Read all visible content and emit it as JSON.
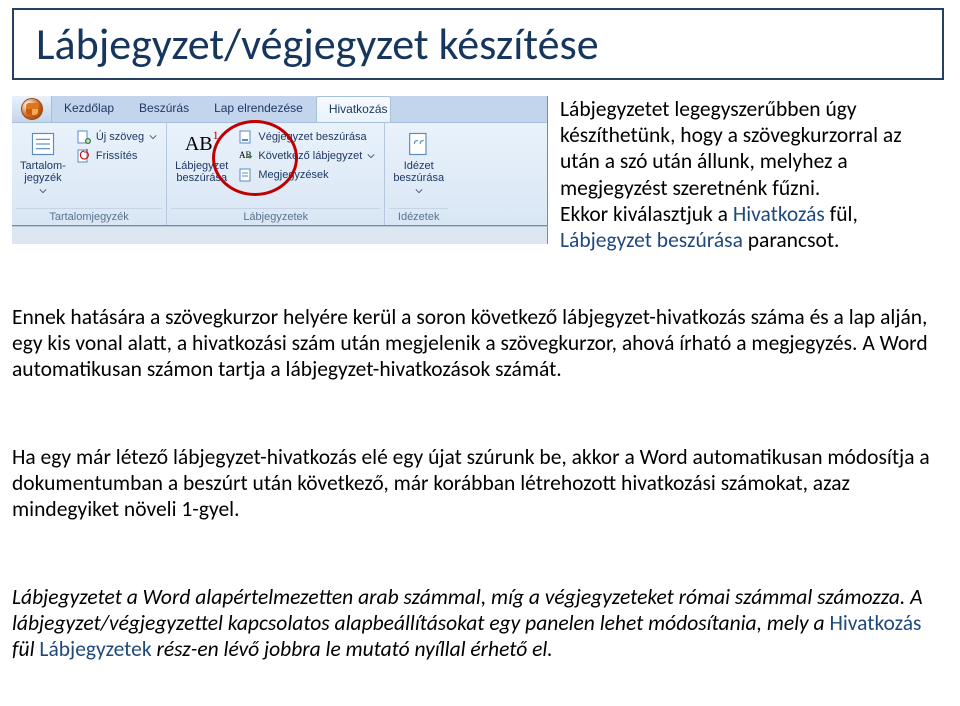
{
  "title": "Lábjegyzet/végjegyzet készítése",
  "ribbon": {
    "tabs": [
      "Kezdőlap",
      "Beszúrás",
      "Lap elrendezése",
      "Hivatkozás"
    ],
    "active_tab": "Hivatkozás",
    "groups": {
      "toc": {
        "big_label": "Tartalom-\njegyzék",
        "items": [
          "Új szöveg",
          "Frissítés"
        ],
        "title": "Tartalomjegyzék"
      },
      "footnotes": {
        "big_label": "Lábjegyzet\nbeszúrása",
        "big_icon_text": "AB",
        "big_icon_sup": "1",
        "items": [
          "Végjegyzet beszúrása",
          "Következő lábjegyzet",
          "Megjegyzések"
        ],
        "title": "Lábjegyzetek"
      },
      "citations": {
        "big_label": "Idézet\nbeszúrása",
        "title": "Idézetek"
      }
    }
  },
  "intro": {
    "line1": "Lábjegyzetet legegyszerűbben úgy készíthetünk, hogy a szövegkurzorral az után a szó után állunk, melyhez a megjegyzést szeretnénk fűzni.",
    "line2_pre": "Ekkor kiválasztjuk a ",
    "line2_hl1": "Hivatkozás",
    "line2_mid": " fül, ",
    "line2_hl2": "Lábjegyzet beszúrása",
    "line2_post": " parancsot."
  },
  "para1": "Ennek hatására a szövegkurzor helyére kerül a soron következő lábjegyzet-hivatkozás száma és a lap alján, egy kis vonal alatt, a hivatkozási szám után megjelenik a szövegkurzor, ahová írható a megjegyzés. A Word automatikusan számon tartja a lábjegyzet-hivatkozások számát.",
  "para2": "Ha egy már létező lábjegyzet-hivatkozás elé egy újat szúrunk be, akkor a Word automatikusan módosítja a dokumentumban a beszúrt után következő, már korábban létrehozott hivatkozási számokat, azaz mindegyiket növeli 1-gyel.",
  "para3": {
    "s1": "Lábjegyzetet a Word alapértelmezetten arab számmal, míg a végjegyzeteket római számmal számozza. A lábjegyzet/végjegyzettel kapcsolatos alapbeállításokat egy panelen lehet módosítania, mely a ",
    "hl1": "Hivatkozás",
    "s2": " fül ",
    "hl2": "Lábjegyzetek",
    "s3": " rész-en lévő jobbra le mutató nyíllal érhető el."
  },
  "icons": {
    "office": "office-button",
    "toc": "toc-icon",
    "addtext": "add-text-icon",
    "refresh": "refresh-icon",
    "footnote": "footnote-ab-icon",
    "endnote": "endnote-icon",
    "next": "next-footnote-icon",
    "show": "show-notes-icon",
    "cite": "citation-icon",
    "dropdown": "chevron-down-icon"
  }
}
